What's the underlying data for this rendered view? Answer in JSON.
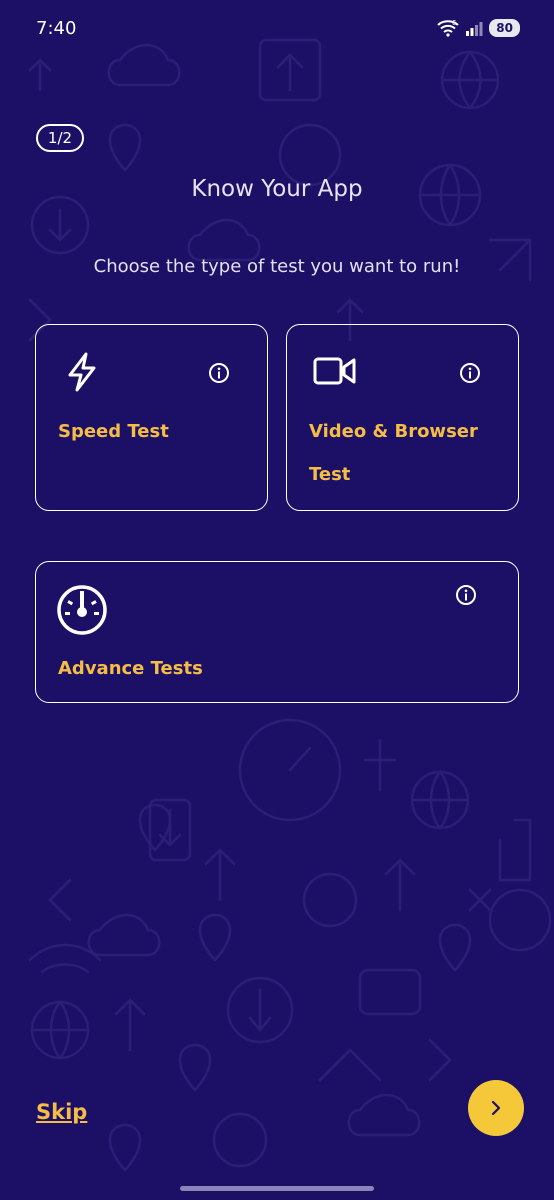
{
  "status_bar": {
    "time": "7:40",
    "battery": "80",
    "wifi_icon": "wifi-icon",
    "signal_icon": "signal-icon"
  },
  "onboarding": {
    "step": "1/2",
    "title": "Know Your App",
    "subtitle": "Choose the type of test you want to run!"
  },
  "cards": {
    "speed": {
      "label": "Speed Test",
      "icon": "lightning-icon"
    },
    "video": {
      "label": "Video & Browser Test",
      "icon": "video-camera-icon"
    },
    "advance": {
      "label": "Advance Tests",
      "icon": "gauge-icon"
    }
  },
  "footer": {
    "skip_label": "Skip",
    "next_icon": "chevron-right-icon"
  },
  "colors": {
    "background": "#1c1066",
    "accent": "#f5bd45",
    "next_button": "#f5c83a"
  }
}
